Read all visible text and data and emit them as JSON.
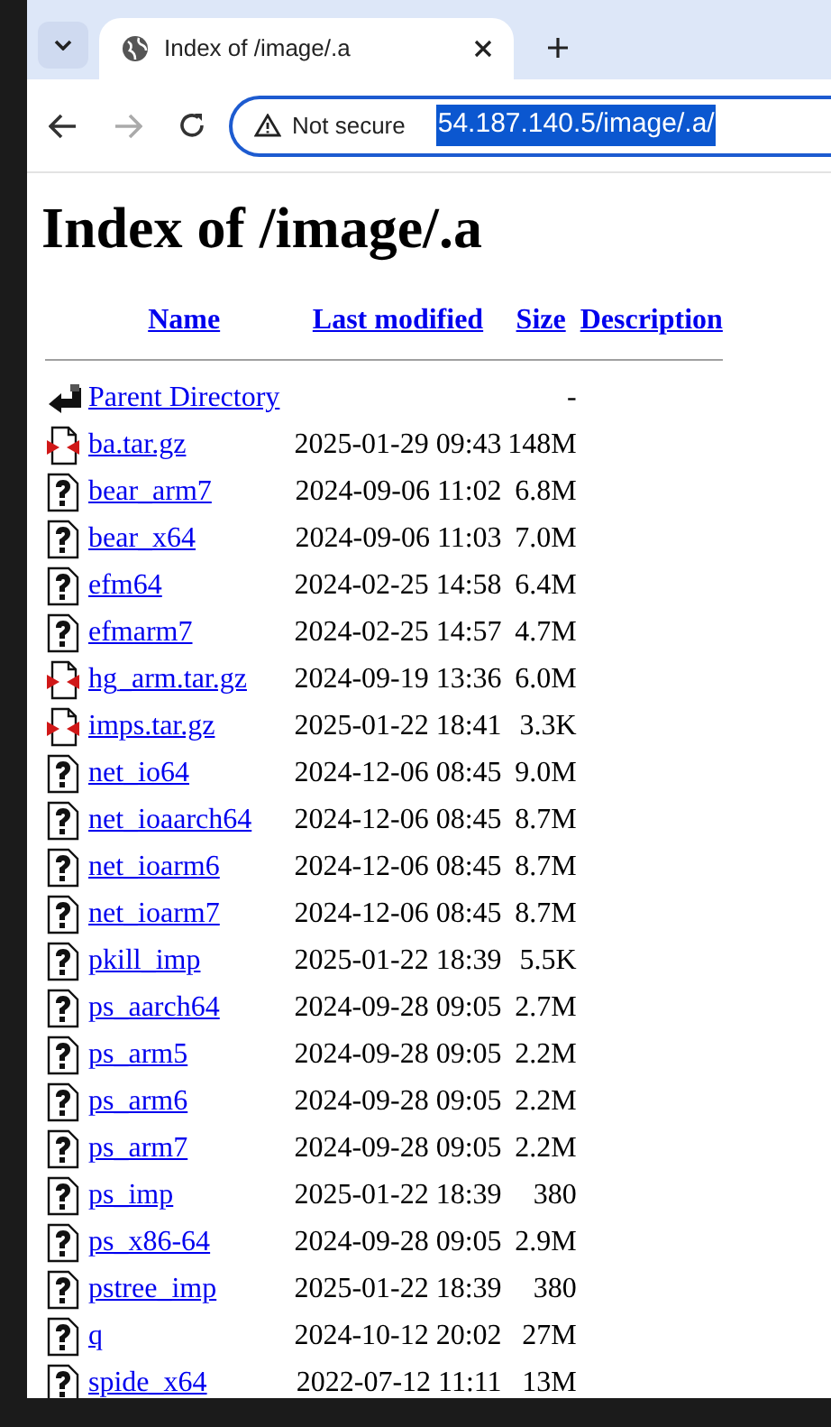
{
  "tab": {
    "title": "Index of /image/.a"
  },
  "address_bar": {
    "security_label": "Not secure",
    "url": "54.187.140.5/image/.a/",
    "url_selected": true
  },
  "page": {
    "heading": "Index of /image/.a",
    "columns": [
      "Name",
      "Last modified",
      "Size",
      "Description"
    ],
    "rows": [
      {
        "kind": "back",
        "name": "Parent Directory",
        "size": "-"
      },
      {
        "kind": "archive",
        "name": "ba.tar.gz",
        "modified": "2025-01-29 09:43",
        "size": "148M"
      },
      {
        "kind": "unknown",
        "name": "bear_arm7",
        "modified": "2024-09-06 11:02",
        "size": "6.8M"
      },
      {
        "kind": "unknown",
        "name": "bear_x64",
        "modified": "2024-09-06 11:03",
        "size": "7.0M"
      },
      {
        "kind": "unknown",
        "name": "efm64",
        "modified": "2024-02-25 14:58",
        "size": "6.4M"
      },
      {
        "kind": "unknown",
        "name": "efmarm7",
        "modified": "2024-02-25 14:57",
        "size": "4.7M"
      },
      {
        "kind": "archive",
        "name": "hg_arm.tar.gz",
        "modified": "2024-09-19 13:36",
        "size": "6.0M"
      },
      {
        "kind": "archive",
        "name": "imps.tar.gz",
        "modified": "2025-01-22 18:41",
        "size": "3.3K"
      },
      {
        "kind": "unknown",
        "name": "net_io64",
        "modified": "2024-12-06 08:45",
        "size": "9.0M"
      },
      {
        "kind": "unknown",
        "name": "net_ioaarch64",
        "modified": "2024-12-06 08:45",
        "size": "8.7M"
      },
      {
        "kind": "unknown",
        "name": "net_ioarm6",
        "modified": "2024-12-06 08:45",
        "size": "8.7M"
      },
      {
        "kind": "unknown",
        "name": "net_ioarm7",
        "modified": "2024-12-06 08:45",
        "size": "8.7M"
      },
      {
        "kind": "unknown",
        "name": "pkill_imp",
        "modified": "2025-01-22 18:39",
        "size": "5.5K"
      },
      {
        "kind": "unknown",
        "name": "ps_aarch64",
        "modified": "2024-09-28 09:05",
        "size": "2.7M"
      },
      {
        "kind": "unknown",
        "name": "ps_arm5",
        "modified": "2024-09-28 09:05",
        "size": "2.2M"
      },
      {
        "kind": "unknown",
        "name": "ps_arm6",
        "modified": "2024-09-28 09:05",
        "size": "2.2M"
      },
      {
        "kind": "unknown",
        "name": "ps_arm7",
        "modified": "2024-09-28 09:05",
        "size": "2.2M"
      },
      {
        "kind": "unknown",
        "name": "ps_imp",
        "modified": "2025-01-22 18:39",
        "size": "380"
      },
      {
        "kind": "unknown",
        "name": "ps_x86-64",
        "modified": "2024-09-28 09:05",
        "size": "2.9M"
      },
      {
        "kind": "unknown",
        "name": "pstree_imp",
        "modified": "2025-01-22 18:39",
        "size": "380"
      },
      {
        "kind": "unknown",
        "name": "q",
        "modified": "2024-10-12 20:02",
        "size": "27M"
      },
      {
        "kind": "unknown",
        "name": "spide_x64",
        "modified": "2022-07-12 11:11",
        "size": "13M"
      }
    ]
  }
}
